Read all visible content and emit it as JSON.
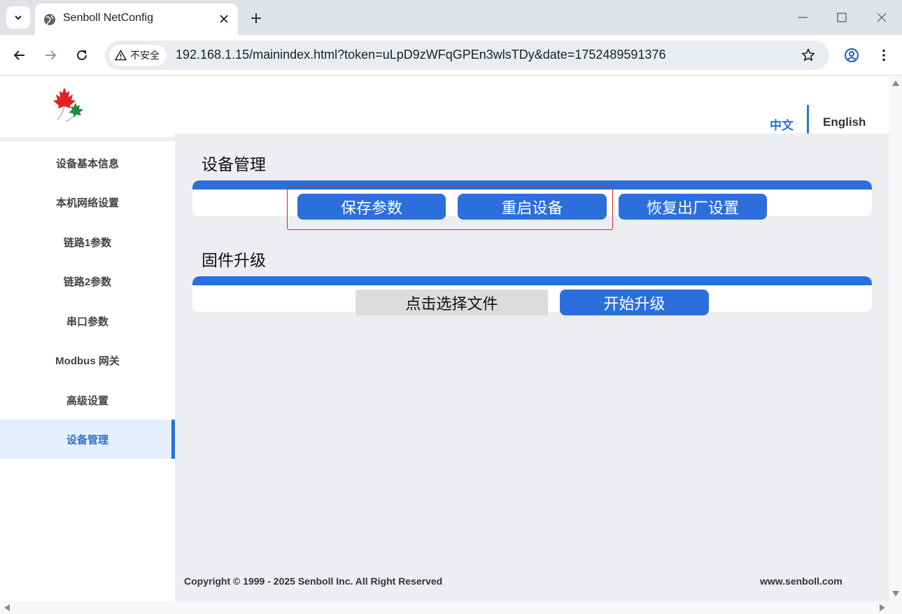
{
  "browser": {
    "tab_title": "Senboll NetConfig",
    "security_label": "不安全",
    "url": "192.168.1.15/mainindex.html?token=uLpD9zWFqGPEn3wlsTDy&date=1752489591376",
    "icons": [
      "tab-search-icon",
      "globe-icon",
      "close-icon",
      "plus-icon",
      "minimize-icon",
      "maximize-icon",
      "window-close-icon",
      "back-arrow-icon",
      "forward-arrow-icon",
      "reload-icon",
      "warning-icon",
      "star-icon",
      "profile-icon",
      "kebab-menu-icon"
    ]
  },
  "header": {
    "lang_zh": "中文",
    "lang_en": "English"
  },
  "sidebar": {
    "items": [
      {
        "label": "设备基本信息"
      },
      {
        "label": "本机网络设置"
      },
      {
        "label": "链路1参数"
      },
      {
        "label": "链路2参数"
      },
      {
        "label": "串口参数"
      },
      {
        "label": "Modbus 网关"
      },
      {
        "label": "高级设置"
      },
      {
        "label": "设备管理"
      }
    ],
    "active_index": 7
  },
  "main": {
    "device_section_title": "设备管理",
    "save_label": "保存参数",
    "restart_label": "重启设备",
    "factory_reset_label": "恢复出厂设置",
    "firmware_section_title": "固件升级",
    "choose_file_label": "点击选择文件",
    "start_upgrade_label": "开始升级"
  },
  "footer": {
    "copyright": "Copyright © 1999 - 2025 Senboll Inc. All Right Reserved",
    "website": "www.senboll.com"
  },
  "colors": {
    "accent": "#2a6fdc",
    "content_bg": "#eceef2",
    "highlight": "#e0251c"
  }
}
